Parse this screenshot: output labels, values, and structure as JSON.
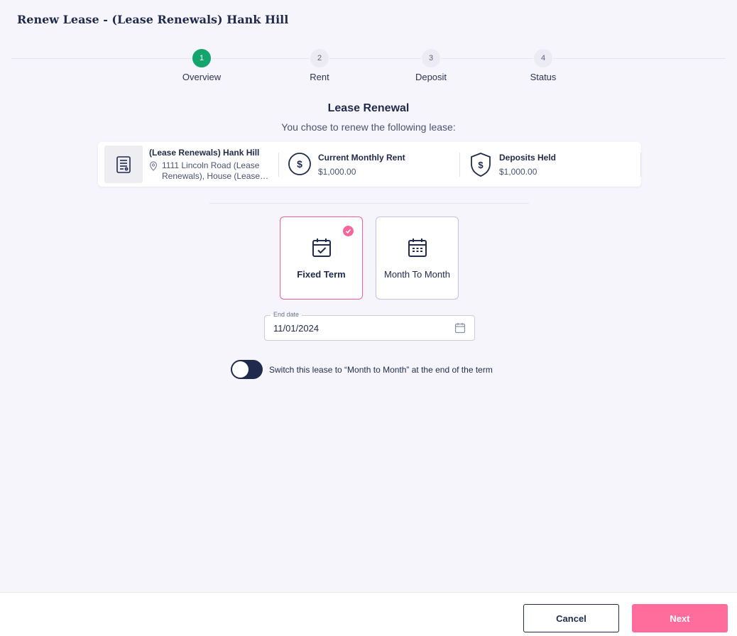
{
  "page": {
    "title": "Renew Lease - (Lease Renewals) Hank Hill"
  },
  "stepper": {
    "steps": [
      {
        "number": "1",
        "label": "Overview",
        "active": true
      },
      {
        "number": "2",
        "label": "Rent",
        "active": false
      },
      {
        "number": "3",
        "label": "Deposit",
        "active": false
      },
      {
        "number": "4",
        "label": "Status",
        "active": false
      }
    ]
  },
  "section": {
    "title": "Lease Renewal",
    "subtitle": "You chose to renew the following lease:"
  },
  "lease": {
    "name": "(Lease Renewals) Hank Hill",
    "address": "1111 Lincoln Road (Lease Renewals), House (Lease…",
    "rent_label": "Current Monthly Rent",
    "rent_value": "$1,000.00",
    "deposits_label": "Deposits Held",
    "deposits_value": "$1,000.00"
  },
  "term_options": {
    "fixed": {
      "label": "Fixed Term",
      "selected": true
    },
    "month_to_month": {
      "label": "Month To Month",
      "selected": false
    }
  },
  "end_date": {
    "label": "End date",
    "value": "11/01/2024"
  },
  "switch": {
    "label": "Switch this lease to “Month to Month” at the end of the term",
    "on": false
  },
  "footer": {
    "cancel_label": "Cancel",
    "next_label": "Next"
  },
  "colors": {
    "accent_pink": "#ff6d9d",
    "active_step_green": "#14a56f",
    "navy": "#1f2a4d"
  }
}
